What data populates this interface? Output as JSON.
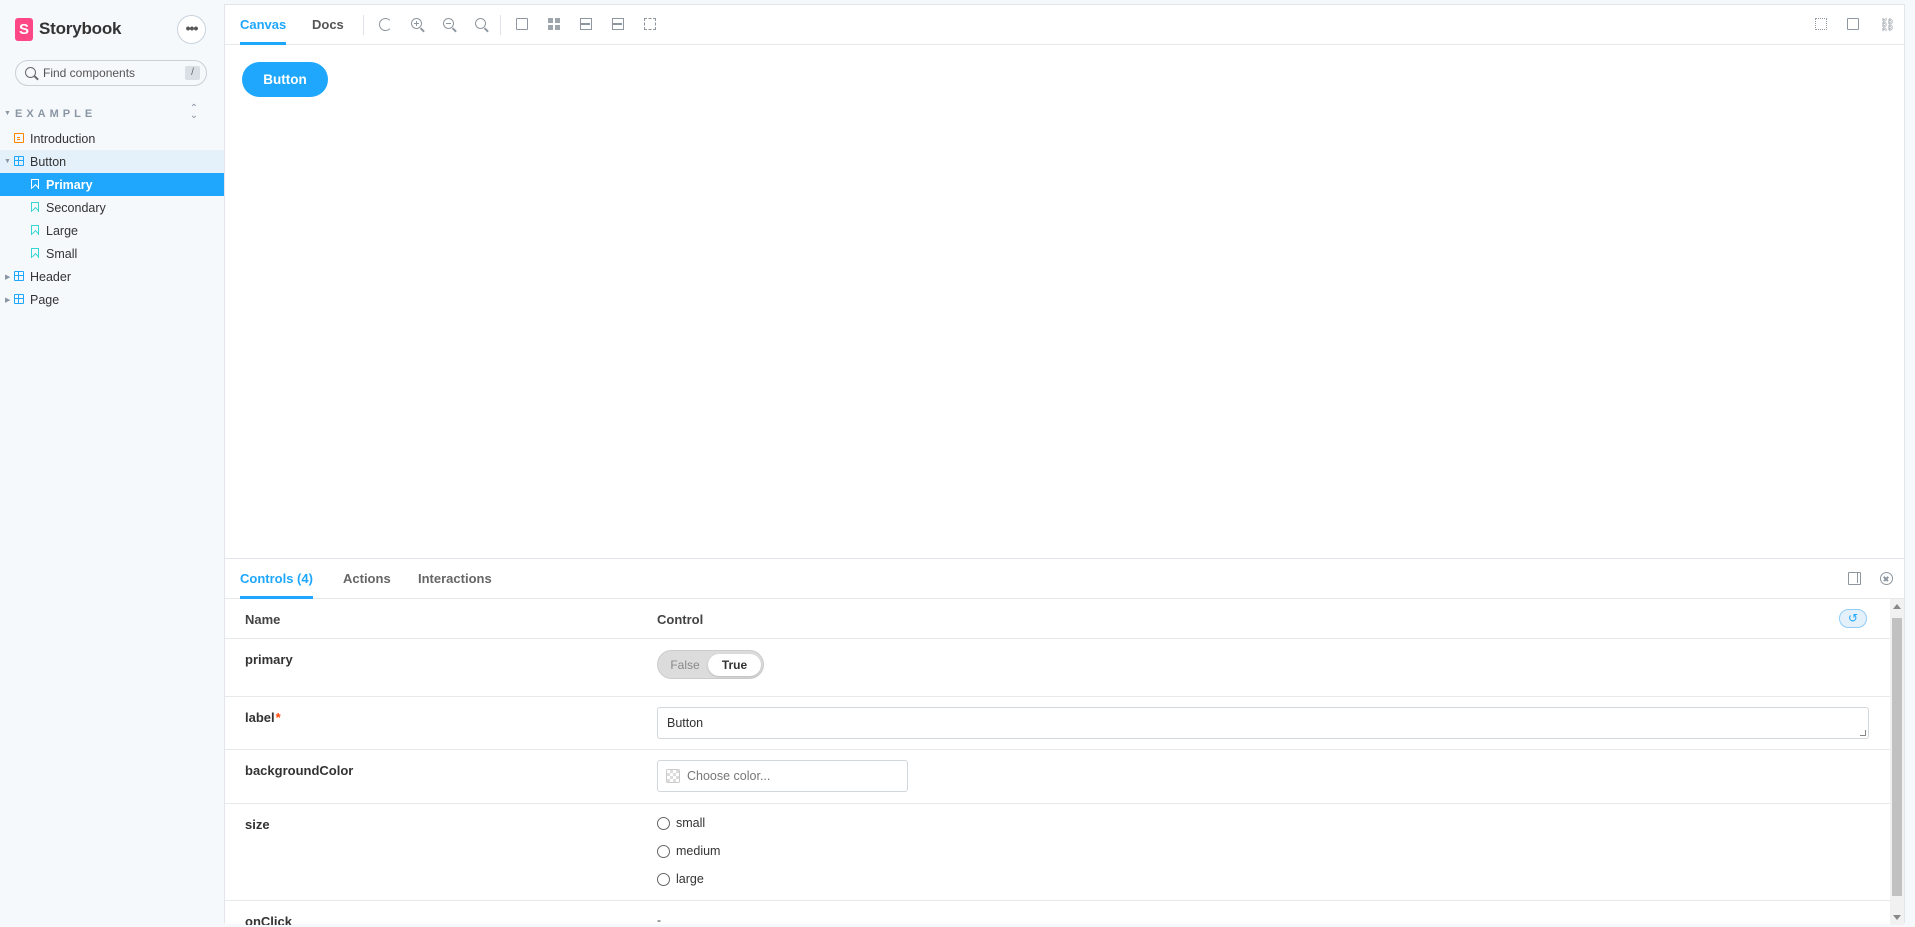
{
  "brand": {
    "logo_letter": "S",
    "name": "Storybook",
    "menu_label": "•••"
  },
  "search": {
    "placeholder": "Find components",
    "shortcut": "/"
  },
  "sidebar": {
    "section_title": "EXAMPLE",
    "items": [
      {
        "label": "Introduction",
        "type": "docs",
        "level": 0
      },
      {
        "label": "Button",
        "type": "component",
        "level": 0,
        "expanded": true
      },
      {
        "label": "Primary",
        "type": "story",
        "level": 1,
        "selected": true
      },
      {
        "label": "Secondary",
        "type": "story",
        "level": 1
      },
      {
        "label": "Large",
        "type": "story",
        "level": 1
      },
      {
        "label": "Small",
        "type": "story",
        "level": 1
      },
      {
        "label": "Header",
        "type": "component",
        "level": 0
      },
      {
        "label": "Page",
        "type": "component",
        "level": 0
      }
    ]
  },
  "toolbar": {
    "tabs": [
      {
        "label": "Canvas",
        "active": true
      },
      {
        "label": "Docs",
        "active": false
      }
    ],
    "tools": [
      "refresh-icon",
      "zoom-in-icon",
      "zoom-out-icon",
      "zoom-reset-icon",
      "background-icon",
      "grid-icon",
      "viewport-icon",
      "measure-icon",
      "outline-icon"
    ],
    "right_tools": [
      "fullscreen-icon",
      "open-new-tab-icon",
      "copy-link-icon"
    ]
  },
  "preview": {
    "button_label": "Button",
    "button_color": "#1ea7fd"
  },
  "addons": {
    "tabs": [
      {
        "label": "Controls (4)",
        "active": true
      },
      {
        "label": "Actions"
      },
      {
        "label": "Interactions"
      }
    ],
    "table": {
      "header": {
        "name": "Name",
        "control": "Control",
        "reset_icon": "↺"
      },
      "rows": {
        "primary": {
          "name": "primary",
          "false_label": "False",
          "true_label": "True",
          "value": true
        },
        "label": {
          "name": "label",
          "required_mark": "*",
          "value": "Button"
        },
        "backgroundColor": {
          "name": "backgroundColor",
          "placeholder": "Choose color..."
        },
        "size": {
          "name": "size",
          "options": [
            "small",
            "medium",
            "large"
          ]
        },
        "onClick": {
          "name": "onClick",
          "value": "-"
        }
      }
    }
  },
  "colors": {
    "accent": "#1ea7fd",
    "brand": "#ff4785",
    "docs_icon": "#ff8500",
    "story_icon": "#37d5d3"
  }
}
